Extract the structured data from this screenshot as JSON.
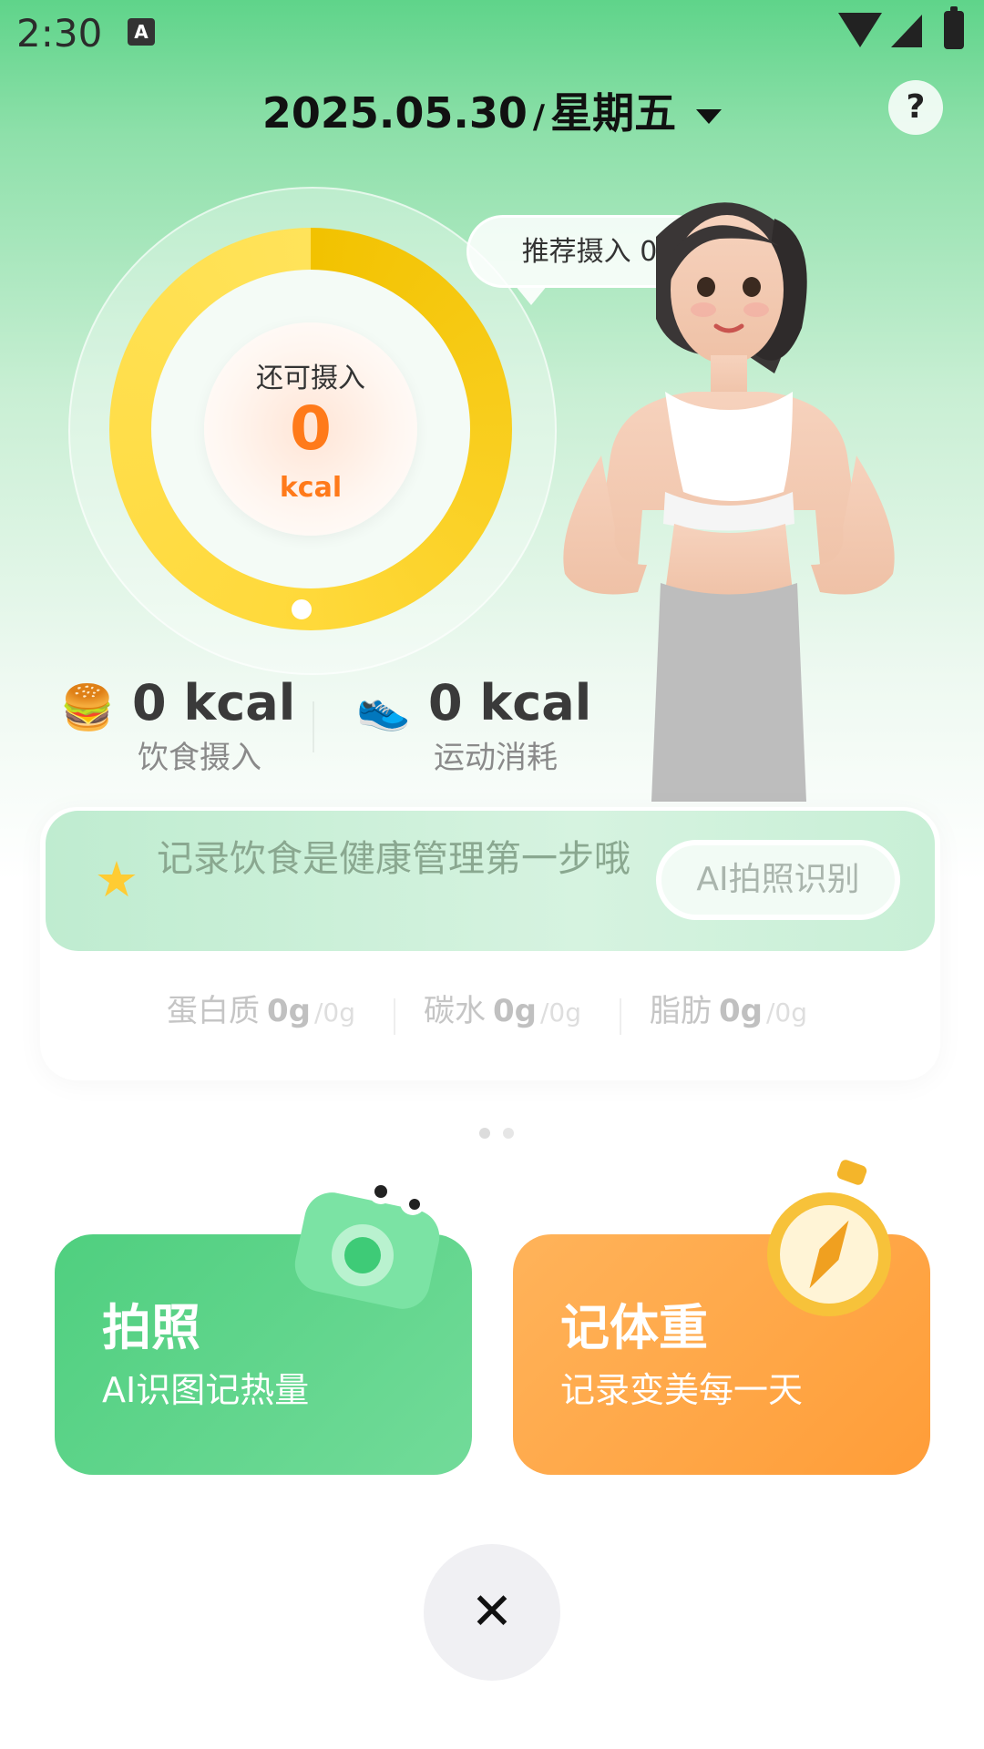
{
  "status_bar": {
    "time": "2:30",
    "keyboard_indicator": "A"
  },
  "header": {
    "date": "2025.05.30",
    "separator": "/",
    "weekday": "星期五",
    "help_label": "?"
  },
  "calorie_ring": {
    "label": "还可摄入",
    "value": "0",
    "unit": "kcal",
    "recommend_bubble": "推荐摄入 0"
  },
  "stats": {
    "food": {
      "icon": "burger-icon",
      "value": "0 kcal",
      "label": "饮食摄入"
    },
    "exercise": {
      "icon": "shoe-icon",
      "value": "0 kcal",
      "label": "运动消耗"
    }
  },
  "tip_banner": {
    "text": "记录饮食是健康管理第一步哦",
    "button": "AI拍照识别"
  },
  "macros": [
    {
      "name": "蛋白质",
      "value": "0g",
      "target": "/0g"
    },
    {
      "name": "碳水",
      "value": "0g",
      "target": "/0g"
    },
    {
      "name": "脂肪",
      "value": "0g",
      "target": "/0g"
    }
  ],
  "actions": {
    "photo": {
      "title": "拍照",
      "subtitle": "AI识图记热量"
    },
    "weight": {
      "title": "记体重",
      "subtitle": "记录变美每一天"
    }
  },
  "close_label": "✕",
  "colors": {
    "primary_green": "#4fcf7f",
    "accent_orange": "#ff7a1a",
    "ring_yellow": "#f2c200",
    "action_orange": "#ffa545"
  }
}
